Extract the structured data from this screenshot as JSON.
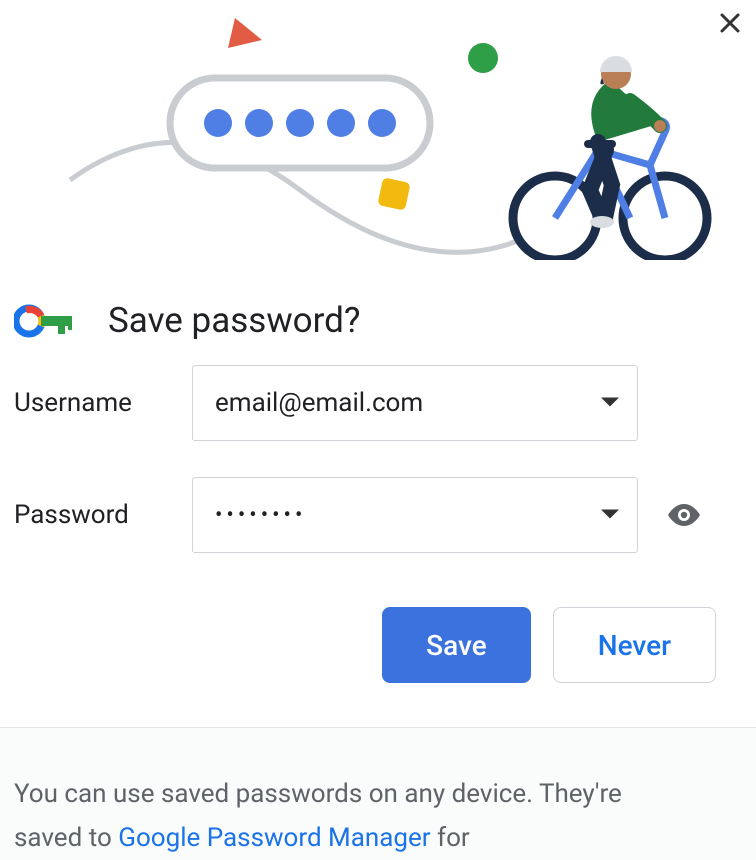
{
  "dialog": {
    "title": "Save password?"
  },
  "form": {
    "username_label": "Username",
    "username_value": "email@email.com",
    "password_label": "Password",
    "password_value": "••••••••"
  },
  "actions": {
    "save_label": "Save",
    "never_label": "Never"
  },
  "footer": {
    "line1_prefix": "You can use saved passwords on any device. They're",
    "line2_prefix": "saved to ",
    "link_text": "Google Password Manager",
    "line2_suffix": " for"
  }
}
